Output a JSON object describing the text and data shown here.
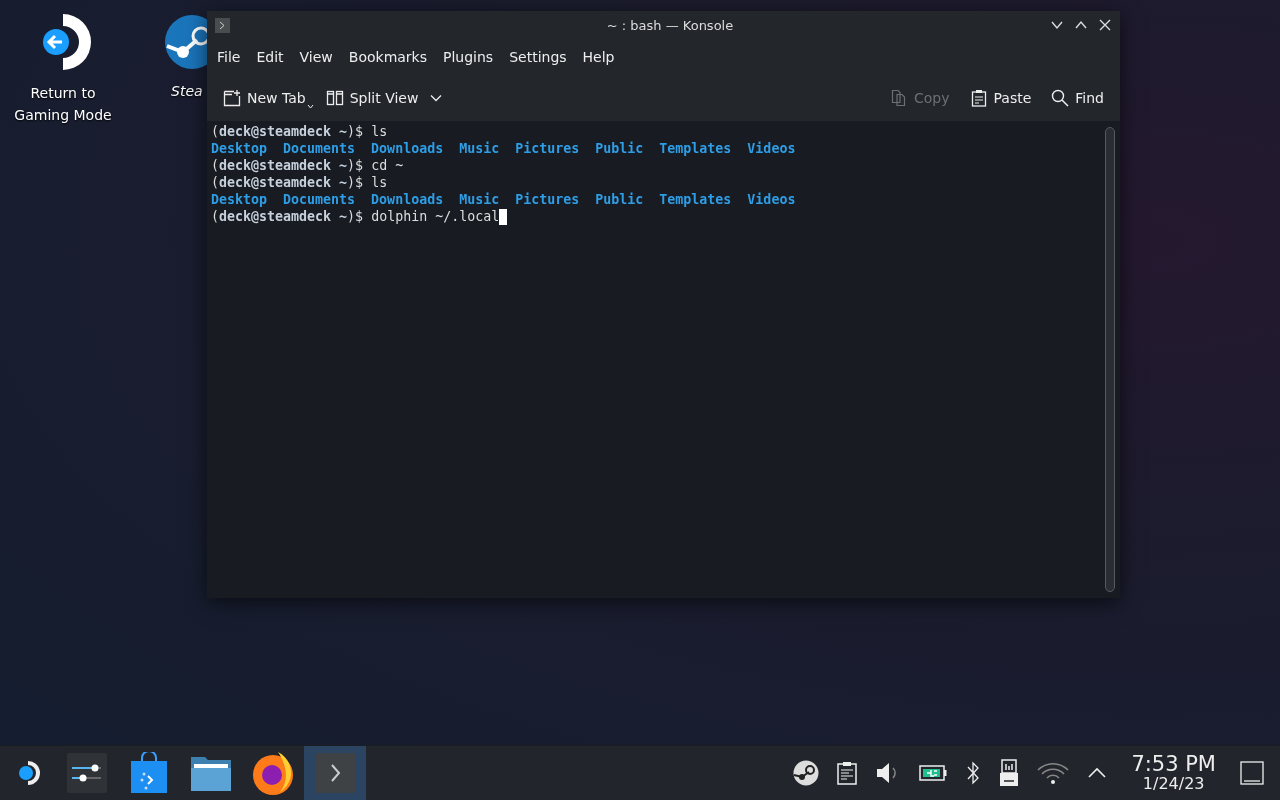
{
  "desktop_icons": [
    {
      "kind": "return",
      "label": "Return to Gaming Mode"
    },
    {
      "kind": "steam",
      "label": "Stea"
    }
  ],
  "window": {
    "title": "~ : bash — Konsole",
    "menu": [
      "File",
      "Edit",
      "View",
      "Bookmarks",
      "Plugins",
      "Settings",
      "Help"
    ],
    "toolbar_left": [
      {
        "kind": "newtab",
        "label": "New Tab",
        "disabled": false
      },
      {
        "kind": "split",
        "label": "Split View",
        "disabled": false
      }
    ],
    "toolbar_right": [
      {
        "kind": "copy",
        "label": "Copy",
        "disabled": true
      },
      {
        "kind": "paste",
        "label": "Paste",
        "disabled": false
      },
      {
        "kind": "find",
        "label": "Find",
        "disabled": false
      }
    ],
    "terminal": [
      {
        "kind": "prompt",
        "text": "(**deck@steamdeck ~**)$ ls",
        "cursor": false
      },
      {
        "kind": "listing",
        "items": [
          "Desktop",
          "Documents",
          "Downloads",
          "Music",
          "Pictures",
          "Public",
          "Templates",
          "Videos"
        ]
      },
      {
        "kind": "prompt",
        "text": "(**deck@steamdeck ~**)$ cd ~",
        "cursor": false
      },
      {
        "kind": "prompt",
        "text": "(**deck@steamdeck ~**)$ ls",
        "cursor": false
      },
      {
        "kind": "listing",
        "items": [
          "Desktop",
          "Documents",
          "Downloads",
          "Music",
          "Pictures",
          "Public",
          "Templates",
          "Videos"
        ]
      },
      {
        "kind": "prompt",
        "text": "(**deck@steamdeck ~**)$ dolphin ~/.local",
        "cursor": true
      }
    ]
  },
  "taskbar": {
    "launchers": [
      {
        "kind": "steamos",
        "selected": false
      },
      {
        "kind": "settings",
        "selected": false
      },
      {
        "kind": "store",
        "selected": false
      },
      {
        "kind": "files",
        "selected": false
      },
      {
        "kind": "firefox",
        "selected": false
      },
      {
        "kind": "terminal",
        "selected": true
      }
    ],
    "tray": [
      {
        "kind": "steam"
      },
      {
        "kind": "clipboard"
      },
      {
        "kind": "volume"
      },
      {
        "kind": "battery"
      },
      {
        "kind": "bluetooth"
      },
      {
        "kind": "usb"
      },
      {
        "kind": "wifi"
      },
      {
        "kind": "expand"
      }
    ],
    "time": "7:53 PM",
    "date": "1/24/23"
  }
}
